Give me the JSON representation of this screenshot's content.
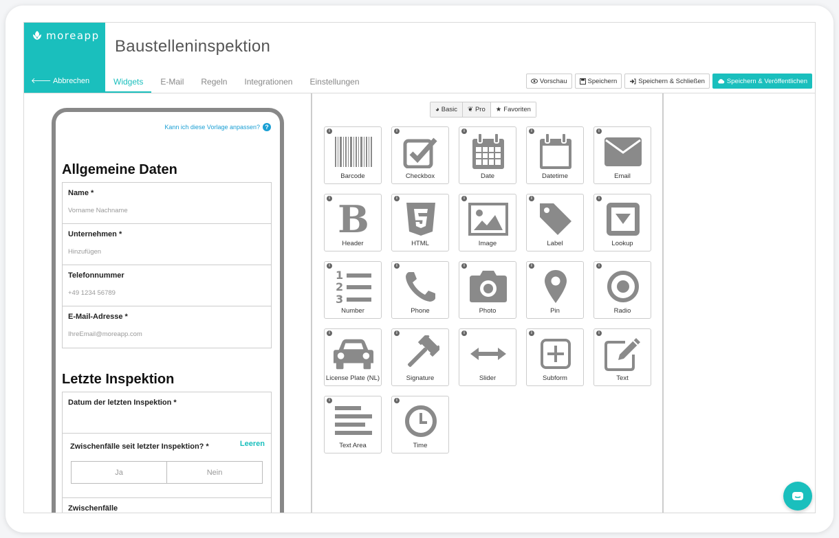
{
  "brand": {
    "name": "moreapp",
    "cancel_label": "Abbrechen"
  },
  "title": "Baustelleninspektion",
  "tabs": [
    {
      "label": "Widgets",
      "active": true
    },
    {
      "label": "E-Mail"
    },
    {
      "label": "Regeln"
    },
    {
      "label": "Integrationen"
    },
    {
      "label": "Einstellungen"
    }
  ],
  "toolbar": {
    "preview": "Vorschau",
    "save": "Speichern",
    "save_close": "Speichern & Schließen",
    "save_publish": "Speichern & Veröffentlichen"
  },
  "form": {
    "help": "Kann ich diese Vorlage anpassen?",
    "section1": "Allgemeine Daten",
    "fields": [
      {
        "label": "Name *",
        "placeholder": "Vorname Nachname"
      },
      {
        "label": "Unternehmen *",
        "placeholder": "Hinzufügen"
      },
      {
        "label": "Telefonnummer",
        "placeholder": "+49 1234 56789"
      },
      {
        "label": "E-Mail-Adresse *",
        "placeholder": "IhreEmail@moreapp.com"
      }
    ],
    "section2": "Letzte Inspektion",
    "date_label": "Datum der letzten Inspektion *",
    "incidents_label": "Zwischenfälle seit letzter Inspektion? *",
    "clear": "Leeren",
    "yes": "Ja",
    "no": "Nein",
    "incidents": "Zwischenfälle"
  },
  "categories": [
    "Basic",
    "Pro",
    "Favoriten"
  ],
  "widgets": [
    {
      "label": "Barcode",
      "icon": "barcode-icon"
    },
    {
      "label": "Checkbox",
      "icon": "checkbox-icon"
    },
    {
      "label": "Date",
      "icon": "calendar-icon"
    },
    {
      "label": "Datetime",
      "icon": "calendar-empty-icon"
    },
    {
      "label": "Email",
      "icon": "envelope-icon"
    },
    {
      "label": "Header",
      "icon": "bold-b-icon"
    },
    {
      "label": "HTML",
      "icon": "html5-icon"
    },
    {
      "label": "Image",
      "icon": "image-icon"
    },
    {
      "label": "Label",
      "icon": "tag-icon"
    },
    {
      "label": "Lookup",
      "icon": "dropdown-icon"
    },
    {
      "label": "Number",
      "icon": "numbered-list-icon"
    },
    {
      "label": "Phone",
      "icon": "phone-icon"
    },
    {
      "label": "Photo",
      "icon": "camera-icon"
    },
    {
      "label": "Pin",
      "icon": "map-pin-icon"
    },
    {
      "label": "Radio",
      "icon": "radio-icon"
    },
    {
      "label": "License Plate (NL)",
      "icon": "car-icon"
    },
    {
      "label": "Signature",
      "icon": "gavel-icon"
    },
    {
      "label": "Slider",
      "icon": "arrows-horizontal-icon"
    },
    {
      "label": "Subform",
      "icon": "plus-square-icon"
    },
    {
      "label": "Text",
      "icon": "edit-icon"
    },
    {
      "label": "Text Area",
      "icon": "align-left-icon"
    },
    {
      "label": "Time",
      "icon": "clock-icon"
    }
  ],
  "colors": {
    "accent": "#1abfbd",
    "icon": "#8a8a8a"
  }
}
